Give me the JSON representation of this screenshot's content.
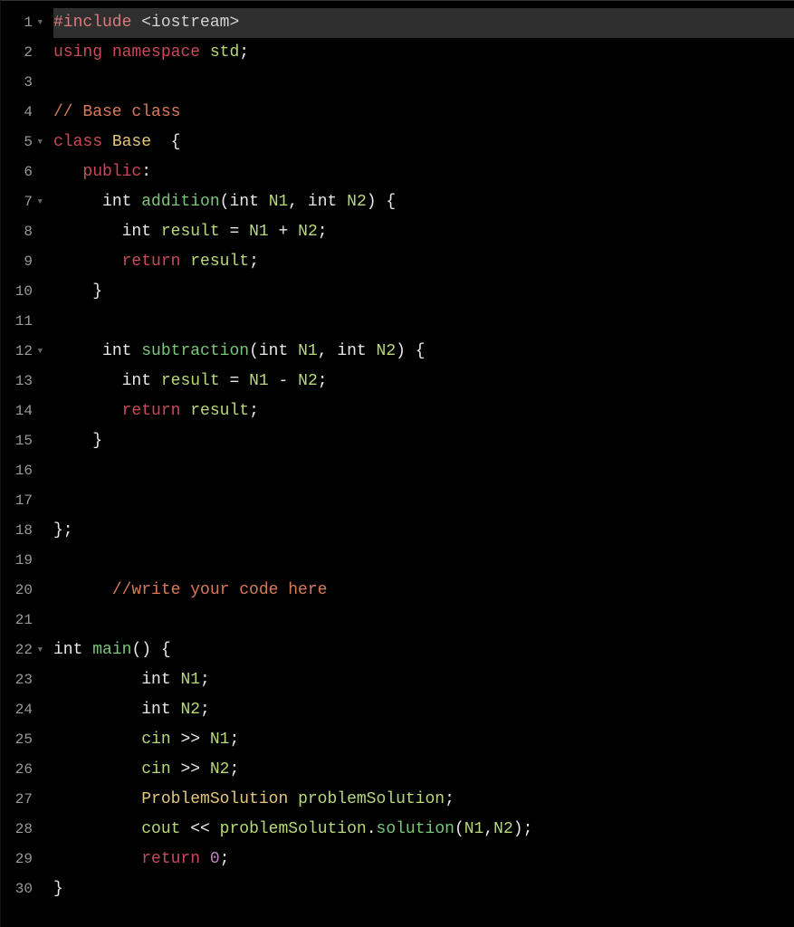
{
  "editor": {
    "highlighted_line": 1,
    "lines": [
      {
        "n": 1,
        "fold": true,
        "tokens": [
          [
            "t-preproc",
            "#include"
          ],
          [
            "t-include",
            " <iostream>"
          ]
        ]
      },
      {
        "n": 2,
        "fold": false,
        "tokens": [
          [
            "t-keyword",
            "using"
          ],
          [
            "t-ident",
            " "
          ],
          [
            "t-keyword",
            "namespace"
          ],
          [
            "t-ident",
            " "
          ],
          [
            "t-var",
            "std"
          ],
          [
            "t-punct",
            ";"
          ]
        ]
      },
      {
        "n": 3,
        "fold": false,
        "tokens": []
      },
      {
        "n": 4,
        "fold": false,
        "tokens": [
          [
            "t-comment",
            "// Base class"
          ]
        ]
      },
      {
        "n": 5,
        "fold": true,
        "tokens": [
          [
            "t-keyword",
            "class"
          ],
          [
            "t-ident",
            " "
          ],
          [
            "t-class",
            "Base"
          ],
          [
            "t-ident",
            "  "
          ],
          [
            "t-punct",
            "{"
          ]
        ]
      },
      {
        "n": 6,
        "fold": false,
        "tokens": [
          [
            "t-ident",
            "   "
          ],
          [
            "t-keyword",
            "public"
          ],
          [
            "t-punct",
            ":"
          ]
        ]
      },
      {
        "n": 7,
        "fold": true,
        "tokens": [
          [
            "t-ident",
            "     "
          ],
          [
            "t-type",
            "int"
          ],
          [
            "t-ident",
            " "
          ],
          [
            "t-func",
            "addition"
          ],
          [
            "t-punct",
            "("
          ],
          [
            "t-type",
            "int"
          ],
          [
            "t-ident",
            " "
          ],
          [
            "t-var",
            "N1"
          ],
          [
            "t-punct",
            ","
          ],
          [
            "t-ident",
            " "
          ],
          [
            "t-type",
            "int"
          ],
          [
            "t-ident",
            " "
          ],
          [
            "t-var",
            "N2"
          ],
          [
            "t-punct",
            ")"
          ],
          [
            "t-ident",
            " "
          ],
          [
            "t-punct",
            "{"
          ]
        ]
      },
      {
        "n": 8,
        "fold": false,
        "tokens": [
          [
            "t-ident",
            "       "
          ],
          [
            "t-type",
            "int"
          ],
          [
            "t-ident",
            " "
          ],
          [
            "t-var",
            "result"
          ],
          [
            "t-ident",
            " "
          ],
          [
            "t-op",
            "="
          ],
          [
            "t-ident",
            " "
          ],
          [
            "t-var",
            "N1"
          ],
          [
            "t-ident",
            " "
          ],
          [
            "t-op",
            "+"
          ],
          [
            "t-ident",
            " "
          ],
          [
            "t-var",
            "N2"
          ],
          [
            "t-punct",
            ";"
          ]
        ]
      },
      {
        "n": 9,
        "fold": false,
        "tokens": [
          [
            "t-ident",
            "       "
          ],
          [
            "t-keyword",
            "return"
          ],
          [
            "t-ident",
            " "
          ],
          [
            "t-var",
            "result"
          ],
          [
            "t-punct",
            ";"
          ]
        ]
      },
      {
        "n": 10,
        "fold": false,
        "tokens": [
          [
            "t-ident",
            "    "
          ],
          [
            "t-punct",
            "}"
          ]
        ]
      },
      {
        "n": 11,
        "fold": false,
        "tokens": []
      },
      {
        "n": 12,
        "fold": true,
        "tokens": [
          [
            "t-ident",
            "     "
          ],
          [
            "t-type",
            "int"
          ],
          [
            "t-ident",
            " "
          ],
          [
            "t-func",
            "subtraction"
          ],
          [
            "t-punct",
            "("
          ],
          [
            "t-type",
            "int"
          ],
          [
            "t-ident",
            " "
          ],
          [
            "t-var",
            "N1"
          ],
          [
            "t-punct",
            ","
          ],
          [
            "t-ident",
            " "
          ],
          [
            "t-type",
            "int"
          ],
          [
            "t-ident",
            " "
          ],
          [
            "t-var",
            "N2"
          ],
          [
            "t-punct",
            ")"
          ],
          [
            "t-ident",
            " "
          ],
          [
            "t-punct",
            "{"
          ]
        ]
      },
      {
        "n": 13,
        "fold": false,
        "tokens": [
          [
            "t-ident",
            "       "
          ],
          [
            "t-type",
            "int"
          ],
          [
            "t-ident",
            " "
          ],
          [
            "t-var",
            "result"
          ],
          [
            "t-ident",
            " "
          ],
          [
            "t-op",
            "="
          ],
          [
            "t-ident",
            " "
          ],
          [
            "t-var",
            "N1"
          ],
          [
            "t-ident",
            " "
          ],
          [
            "t-op",
            "-"
          ],
          [
            "t-ident",
            " "
          ],
          [
            "t-var",
            "N2"
          ],
          [
            "t-punct",
            ";"
          ]
        ]
      },
      {
        "n": 14,
        "fold": false,
        "tokens": [
          [
            "t-ident",
            "       "
          ],
          [
            "t-keyword",
            "return"
          ],
          [
            "t-ident",
            " "
          ],
          [
            "t-var",
            "result"
          ],
          [
            "t-punct",
            ";"
          ]
        ]
      },
      {
        "n": 15,
        "fold": false,
        "tokens": [
          [
            "t-ident",
            "    "
          ],
          [
            "t-punct",
            "}"
          ]
        ]
      },
      {
        "n": 16,
        "fold": false,
        "tokens": []
      },
      {
        "n": 17,
        "fold": false,
        "tokens": []
      },
      {
        "n": 18,
        "fold": false,
        "tokens": [
          [
            "t-punct",
            "};"
          ]
        ]
      },
      {
        "n": 19,
        "fold": false,
        "tokens": []
      },
      {
        "n": 20,
        "fold": false,
        "tokens": [
          [
            "t-ident",
            "      "
          ],
          [
            "t-comment",
            "//write your code here"
          ]
        ]
      },
      {
        "n": 21,
        "fold": false,
        "tokens": []
      },
      {
        "n": 22,
        "fold": true,
        "tokens": [
          [
            "t-type",
            "int"
          ],
          [
            "t-ident",
            " "
          ],
          [
            "t-func",
            "main"
          ],
          [
            "t-punct",
            "()"
          ],
          [
            "t-ident",
            " "
          ],
          [
            "t-punct",
            "{"
          ]
        ]
      },
      {
        "n": 23,
        "fold": false,
        "tokens": [
          [
            "t-ident",
            "         "
          ],
          [
            "t-type",
            "int"
          ],
          [
            "t-ident",
            " "
          ],
          [
            "t-var",
            "N1"
          ],
          [
            "t-punct",
            ";"
          ]
        ]
      },
      {
        "n": 24,
        "fold": false,
        "tokens": [
          [
            "t-ident",
            "         "
          ],
          [
            "t-type",
            "int"
          ],
          [
            "t-ident",
            " "
          ],
          [
            "t-var",
            "N2"
          ],
          [
            "t-punct",
            ";"
          ]
        ]
      },
      {
        "n": 25,
        "fold": false,
        "tokens": [
          [
            "t-ident",
            "         "
          ],
          [
            "t-var",
            "cin"
          ],
          [
            "t-ident",
            " "
          ],
          [
            "t-op",
            ">>"
          ],
          [
            "t-ident",
            " "
          ],
          [
            "t-var",
            "N1"
          ],
          [
            "t-punct",
            ";"
          ]
        ]
      },
      {
        "n": 26,
        "fold": false,
        "tokens": [
          [
            "t-ident",
            "         "
          ],
          [
            "t-var",
            "cin"
          ],
          [
            "t-ident",
            " "
          ],
          [
            "t-op",
            ">>"
          ],
          [
            "t-ident",
            " "
          ],
          [
            "t-var",
            "N2"
          ],
          [
            "t-punct",
            ";"
          ]
        ]
      },
      {
        "n": 27,
        "fold": false,
        "tokens": [
          [
            "t-ident",
            "         "
          ],
          [
            "t-class",
            "ProblemSolution"
          ],
          [
            "t-ident",
            " "
          ],
          [
            "t-var",
            "problemSolution"
          ],
          [
            "t-punct",
            ";"
          ]
        ]
      },
      {
        "n": 28,
        "fold": false,
        "tokens": [
          [
            "t-ident",
            "         "
          ],
          [
            "t-var",
            "cout"
          ],
          [
            "t-ident",
            " "
          ],
          [
            "t-op",
            "<<"
          ],
          [
            "t-ident",
            " "
          ],
          [
            "t-var",
            "problemSolution"
          ],
          [
            "t-punct",
            "."
          ],
          [
            "t-func",
            "solution"
          ],
          [
            "t-punct",
            "("
          ],
          [
            "t-var",
            "N1"
          ],
          [
            "t-punct",
            ","
          ],
          [
            "t-var",
            "N2"
          ],
          [
            "t-punct",
            ")"
          ],
          [
            "t-punct",
            ";"
          ]
        ]
      },
      {
        "n": 29,
        "fold": false,
        "tokens": [
          [
            "t-ident",
            "         "
          ],
          [
            "t-keyword",
            "return"
          ],
          [
            "t-ident",
            " "
          ],
          [
            "t-num",
            "0"
          ],
          [
            "t-punct",
            ";"
          ]
        ]
      },
      {
        "n": 30,
        "fold": false,
        "tokens": [
          [
            "t-punct",
            "}"
          ]
        ]
      }
    ]
  }
}
